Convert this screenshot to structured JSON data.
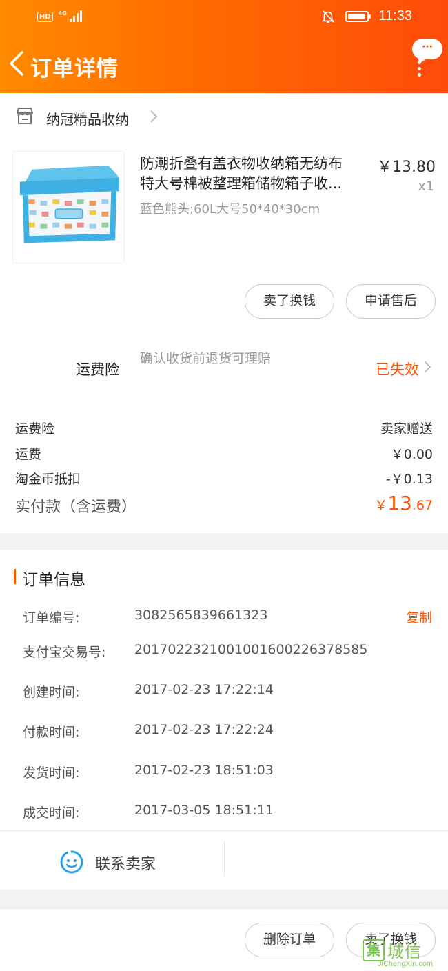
{
  "status_bar": {
    "hd": "HD",
    "network": "4G",
    "time": "11:33"
  },
  "nav": {
    "title": "订单详情",
    "more": "···"
  },
  "shop": {
    "name": "纳冠精品收纳"
  },
  "product": {
    "title_line1": "防潮折叠有盖衣物收纳箱无纺布",
    "title_line2": "特大号棉被整理箱储物箱子收...",
    "sku": "蓝色熊头;60L大号50*40*30cm",
    "price": "￥13.80",
    "qty": "x1"
  },
  "actions": {
    "sell": "卖了换钱",
    "after_sale": "申请售后"
  },
  "insurance": {
    "label": "运费险",
    "desc": "确认收货前退货可理赔",
    "status": "已失效"
  },
  "fees": {
    "insurance_label": "运费险",
    "insurance_value": "卖家赠送",
    "shipping_label": "运费",
    "shipping_value": "￥0.00",
    "coin_label": "淘金币抵扣",
    "coin_value": "-￥0.13",
    "total_label": "实付款（含运费）",
    "total_symbol": "￥",
    "total_int": "13",
    "total_dec": ".67"
  },
  "order_info": {
    "title": "订单信息",
    "copy": "复制",
    "rows": [
      {
        "key": "订单编号:",
        "value": "3082565839661323"
      },
      {
        "key": "支付宝交易号:",
        "value": "2017022321001001600226378585"
      },
      {
        "key": "创建时间:",
        "value": "2017-02-23 17:22:14"
      },
      {
        "key": "付款时间:",
        "value": "2017-02-23 17:22:24"
      },
      {
        "key": "发货时间:",
        "value": "2017-02-23 18:51:03"
      },
      {
        "key": "成交时间:",
        "value": "2017-03-05 18:51:11"
      }
    ]
  },
  "contact": {
    "label": "联系卖家"
  },
  "bottom": {
    "delete": "删除订单",
    "sell": "卖了换钱"
  },
  "watermark": {
    "text": "城信",
    "box": "集",
    "url": "JiChengXin.com"
  },
  "colors": {
    "accent": "#ff5000",
    "header_start": "#ff8a00",
    "header_end": "#ff4b0a"
  }
}
